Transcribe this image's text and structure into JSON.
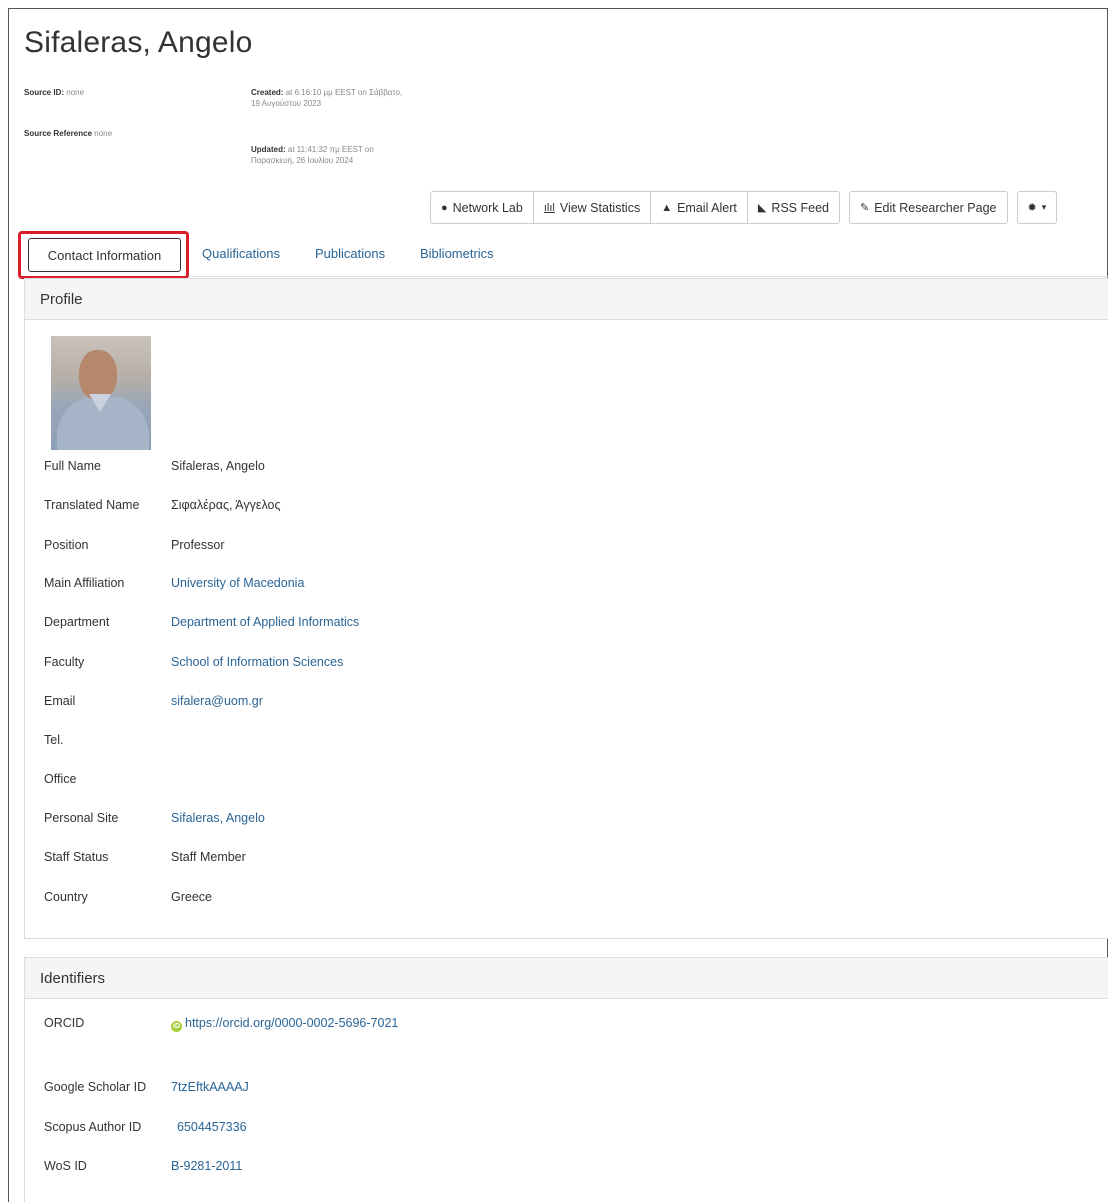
{
  "page": {
    "title": "Sifaleras, Angelo",
    "source_id_label": "Source ID:",
    "source_id_value": "none",
    "source_ref_label": "Source Reference",
    "source_ref_value": "none",
    "created_label": "Created:",
    "created_text": "at 6:16:10 μμ EEST on Σάββατο,",
    "created_text2": "19 Αυγούστου 2023",
    "updated_label": "Updated:",
    "updated_text": "at 11:41:32 πμ EEST on",
    "updated_text2": "Παρασκευή, 26 Ιουλίου 2024"
  },
  "toolbar": {
    "network_lab": "Network Lab",
    "view_statistics": "View Statistics",
    "email_alert": "Email Alert",
    "rss_feed": "RSS Feed",
    "edit_page": "Edit Researcher Page",
    "settings_caret": "▾"
  },
  "tabs": {
    "contact": "Contact Information",
    "qualifications": "Qualifications",
    "publications": "Publications",
    "bibliometrics": "Bibliometrics"
  },
  "profile": {
    "heading": "Profile",
    "rows": [
      {
        "label": "Full Name",
        "value": "Sifaleras, Angelo"
      },
      {
        "label": "Translated Name",
        "value": "Σιφαλέρας, Άγγελος"
      },
      {
        "label": "Position",
        "value": "Professor"
      },
      {
        "label": "Main Affiliation",
        "value": "University of Macedonia"
      },
      {
        "label": "Department",
        "value": "Department of Applied Informatics"
      },
      {
        "label": "Faculty",
        "value": "School of Information Sciences"
      },
      {
        "label": "Email",
        "value": "sifalera@uom.gr"
      },
      {
        "label": "Tel.",
        "value": ""
      },
      {
        "label": "Office",
        "value": ""
      },
      {
        "label": "Personal Site",
        "value": "Sifaleras, Angelo"
      },
      {
        "label": "Staff Status",
        "value": "Staff Member"
      },
      {
        "label": "Country",
        "value": "Greece"
      }
    ]
  },
  "identifiers": {
    "heading": "Identifiers",
    "orcid_label": "ORCID",
    "orcid_value": "https://orcid.org/0000-0002-5696-7021",
    "orcid_icon_text": "iD",
    "scholar_label": "Google Scholar ID",
    "scholar_value": "7tzEftkAAAAJ",
    "scopus_label": "Scopus Author ID",
    "scopus_value": "6504457336",
    "wos_label": "WoS ID",
    "wos_value": "B-9281-2011"
  },
  "colors": {
    "link": "#2a6496",
    "highlight": "#d9202a",
    "panel_head_bg": "#f5f5f5"
  }
}
